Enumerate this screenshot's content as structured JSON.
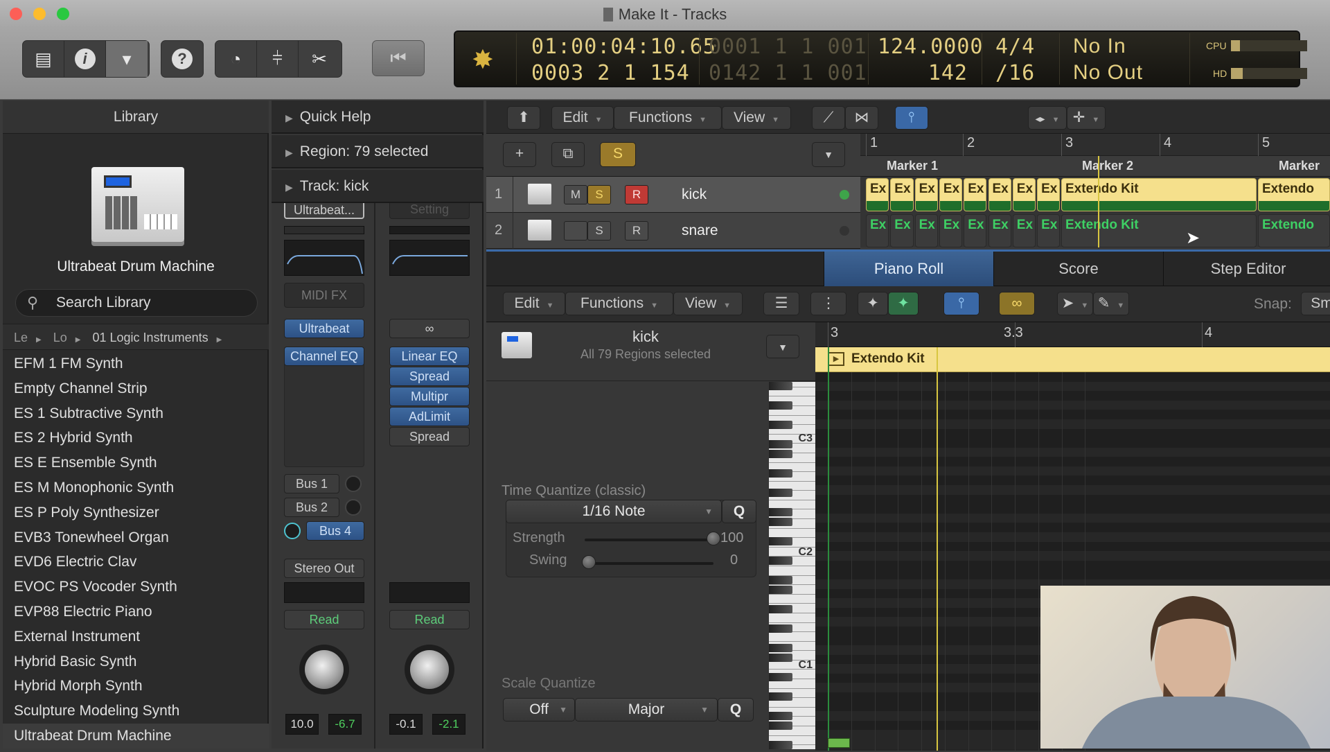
{
  "window": {
    "title": "Make It - Tracks"
  },
  "toolbar": {
    "buttons": [
      "library-icon",
      "inspector-icon",
      "toolbar-icon",
      "help-icon",
      "smart-controls-icon",
      "mixer-icon",
      "editors-icon"
    ]
  },
  "lcd": {
    "smpte": "01:00:04:10.65",
    "bars_dim": "000",
    "bars": "3  2  1  154",
    "locator_top": "0001  1  1  001",
    "locator_bottom": "0142  1  1  001",
    "tempo": "124.0000",
    "tempo_sub": "142",
    "sig_top": "4/4",
    "sig_bottom": "/16",
    "midi_in": "No In",
    "midi_out": "No Out",
    "cpu_label": "CPU",
    "hd_label": "HD",
    "cpu_load": 0.12,
    "hd_load": 0.15
  },
  "library": {
    "header": "Library",
    "patch_name": "Ultrabeat Drum Machine",
    "search_placeholder": "Search Library",
    "path": [
      "Le",
      "Lo",
      "01 Logic Instruments"
    ],
    "items": [
      "EFM 1 FM Synth",
      "Empty Channel Strip",
      "ES 1 Subtractive Synth",
      "ES 2 Hybrid Synth",
      "ES E Ensemble Synth",
      "ES M Monophonic Synth",
      "ES P Poly Synthesizer",
      "EVB3 Tonewheel Organ",
      "EVD6 Electric Clav",
      "EVOC PS Vocoder Synth",
      "EVP88 Electric Piano",
      "External Instrument",
      "Hybrid Basic Synth",
      "Hybrid Morph Synth",
      "Sculpture Modeling Synth",
      "Ultrabeat Drum Machine"
    ],
    "selected": "Ultrabeat Drum Machine"
  },
  "inspector": {
    "quick_help": "Quick Help",
    "region": "Region: 79 selected",
    "track": "Track:  kick",
    "strip1": {
      "setting": "Ultrabeat...",
      "midi_fx": "MIDI FX",
      "instrument": "Ultrabeat",
      "plugins": [
        "Channel EQ"
      ],
      "sends": [
        "Bus 1",
        "Bus 2",
        "Bus 4"
      ],
      "output": "Stereo Out",
      "automation": "Read",
      "volume": "10.0",
      "peak": "-6.7"
    },
    "strip2": {
      "setting": "Setting",
      "link": "∞",
      "plugins": [
        "Linear EQ",
        "Spread",
        "Multipr",
        "AdLimit",
        "Spread"
      ],
      "automation": "Read",
      "volume": "-0.1",
      "peak": "-2.1"
    }
  },
  "tracks_area": {
    "menus": [
      "Edit",
      "Functions",
      "View"
    ],
    "global_solo": "S",
    "ruler": [
      "1",
      "2",
      "3",
      "4",
      "5"
    ],
    "markers": [
      "Marker 1",
      "Marker 2",
      "Marker"
    ],
    "tracks": [
      {
        "num": "1",
        "name": "kick",
        "mute": "M",
        "solo": "S",
        "rec": "R",
        "selected": true
      },
      {
        "num": "2",
        "name": "snare",
        "mute": "",
        "solo": "S",
        "rec": "R",
        "selected": false
      }
    ],
    "region_short": "Ex",
    "region_long": "Extendo Kit",
    "region_cut": "Extendo"
  },
  "editor": {
    "tabs": [
      "Piano Roll",
      "Score",
      "Step Editor"
    ],
    "active_tab": "Piano Roll",
    "menus": [
      "Edit",
      "Functions",
      "View"
    ],
    "snap_label": "Snap:",
    "snap_value": "Sm",
    "track_name": "kick",
    "track_sub": "All 79 Regions selected",
    "ruler": [
      "3",
      "3.3",
      "4"
    ],
    "region_name": "Extendo Kit",
    "time_quantize": {
      "label": "Time Quantize (classic)",
      "value": "1/16 Note",
      "q": "Q",
      "strength_label": "Strength",
      "strength": "100",
      "swing_label": "Swing",
      "swing": "0"
    },
    "scale_quantize": {
      "label": "Scale Quantize",
      "root": "Off",
      "scale": "Major",
      "q": "Q"
    },
    "keys": [
      "C3",
      "C2",
      "C1"
    ]
  },
  "colors": {
    "accent_blue": "#3b6aa8",
    "region_yellow": "#f5e08c",
    "region_green": "#3ed064",
    "lcd": "#e4cf82"
  }
}
